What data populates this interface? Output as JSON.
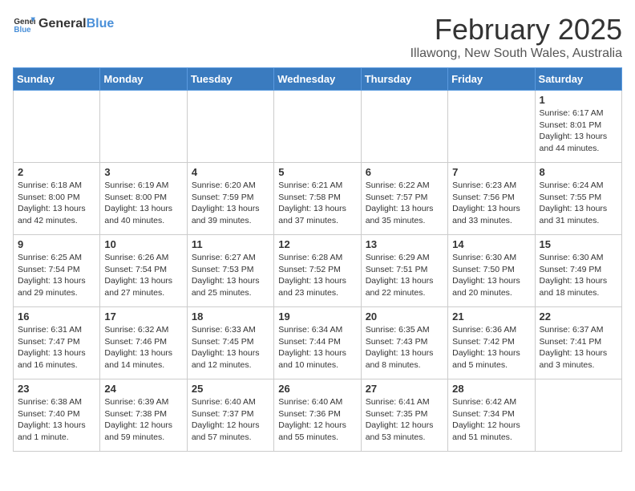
{
  "header": {
    "logo_general": "General",
    "logo_blue": "Blue",
    "month": "February 2025",
    "location": "Illawong, New South Wales, Australia"
  },
  "weekdays": [
    "Sunday",
    "Monday",
    "Tuesday",
    "Wednesday",
    "Thursday",
    "Friday",
    "Saturday"
  ],
  "weeks": [
    [
      {
        "day": "",
        "info": ""
      },
      {
        "day": "",
        "info": ""
      },
      {
        "day": "",
        "info": ""
      },
      {
        "day": "",
        "info": ""
      },
      {
        "day": "",
        "info": ""
      },
      {
        "day": "",
        "info": ""
      },
      {
        "day": "1",
        "info": "Sunrise: 6:17 AM\nSunset: 8:01 PM\nDaylight: 13 hours\nand 44 minutes."
      }
    ],
    [
      {
        "day": "2",
        "info": "Sunrise: 6:18 AM\nSunset: 8:00 PM\nDaylight: 13 hours\nand 42 minutes."
      },
      {
        "day": "3",
        "info": "Sunrise: 6:19 AM\nSunset: 8:00 PM\nDaylight: 13 hours\nand 40 minutes."
      },
      {
        "day": "4",
        "info": "Sunrise: 6:20 AM\nSunset: 7:59 PM\nDaylight: 13 hours\nand 39 minutes."
      },
      {
        "day": "5",
        "info": "Sunrise: 6:21 AM\nSunset: 7:58 PM\nDaylight: 13 hours\nand 37 minutes."
      },
      {
        "day": "6",
        "info": "Sunrise: 6:22 AM\nSunset: 7:57 PM\nDaylight: 13 hours\nand 35 minutes."
      },
      {
        "day": "7",
        "info": "Sunrise: 6:23 AM\nSunset: 7:56 PM\nDaylight: 13 hours\nand 33 minutes."
      },
      {
        "day": "8",
        "info": "Sunrise: 6:24 AM\nSunset: 7:55 PM\nDaylight: 13 hours\nand 31 minutes."
      }
    ],
    [
      {
        "day": "9",
        "info": "Sunrise: 6:25 AM\nSunset: 7:54 PM\nDaylight: 13 hours\nand 29 minutes."
      },
      {
        "day": "10",
        "info": "Sunrise: 6:26 AM\nSunset: 7:54 PM\nDaylight: 13 hours\nand 27 minutes."
      },
      {
        "day": "11",
        "info": "Sunrise: 6:27 AM\nSunset: 7:53 PM\nDaylight: 13 hours\nand 25 minutes."
      },
      {
        "day": "12",
        "info": "Sunrise: 6:28 AM\nSunset: 7:52 PM\nDaylight: 13 hours\nand 23 minutes."
      },
      {
        "day": "13",
        "info": "Sunrise: 6:29 AM\nSunset: 7:51 PM\nDaylight: 13 hours\nand 22 minutes."
      },
      {
        "day": "14",
        "info": "Sunrise: 6:30 AM\nSunset: 7:50 PM\nDaylight: 13 hours\nand 20 minutes."
      },
      {
        "day": "15",
        "info": "Sunrise: 6:30 AM\nSunset: 7:49 PM\nDaylight: 13 hours\nand 18 minutes."
      }
    ],
    [
      {
        "day": "16",
        "info": "Sunrise: 6:31 AM\nSunset: 7:47 PM\nDaylight: 13 hours\nand 16 minutes."
      },
      {
        "day": "17",
        "info": "Sunrise: 6:32 AM\nSunset: 7:46 PM\nDaylight: 13 hours\nand 14 minutes."
      },
      {
        "day": "18",
        "info": "Sunrise: 6:33 AM\nSunset: 7:45 PM\nDaylight: 13 hours\nand 12 minutes."
      },
      {
        "day": "19",
        "info": "Sunrise: 6:34 AM\nSunset: 7:44 PM\nDaylight: 13 hours\nand 10 minutes."
      },
      {
        "day": "20",
        "info": "Sunrise: 6:35 AM\nSunset: 7:43 PM\nDaylight: 13 hours\nand 8 minutes."
      },
      {
        "day": "21",
        "info": "Sunrise: 6:36 AM\nSunset: 7:42 PM\nDaylight: 13 hours\nand 5 minutes."
      },
      {
        "day": "22",
        "info": "Sunrise: 6:37 AM\nSunset: 7:41 PM\nDaylight: 13 hours\nand 3 minutes."
      }
    ],
    [
      {
        "day": "23",
        "info": "Sunrise: 6:38 AM\nSunset: 7:40 PM\nDaylight: 13 hours\nand 1 minute."
      },
      {
        "day": "24",
        "info": "Sunrise: 6:39 AM\nSunset: 7:38 PM\nDaylight: 12 hours\nand 59 minutes."
      },
      {
        "day": "25",
        "info": "Sunrise: 6:40 AM\nSunset: 7:37 PM\nDaylight: 12 hours\nand 57 minutes."
      },
      {
        "day": "26",
        "info": "Sunrise: 6:40 AM\nSunset: 7:36 PM\nDaylight: 12 hours\nand 55 minutes."
      },
      {
        "day": "27",
        "info": "Sunrise: 6:41 AM\nSunset: 7:35 PM\nDaylight: 12 hours\nand 53 minutes."
      },
      {
        "day": "28",
        "info": "Sunrise: 6:42 AM\nSunset: 7:34 PM\nDaylight: 12 hours\nand 51 minutes."
      },
      {
        "day": "",
        "info": ""
      }
    ]
  ]
}
